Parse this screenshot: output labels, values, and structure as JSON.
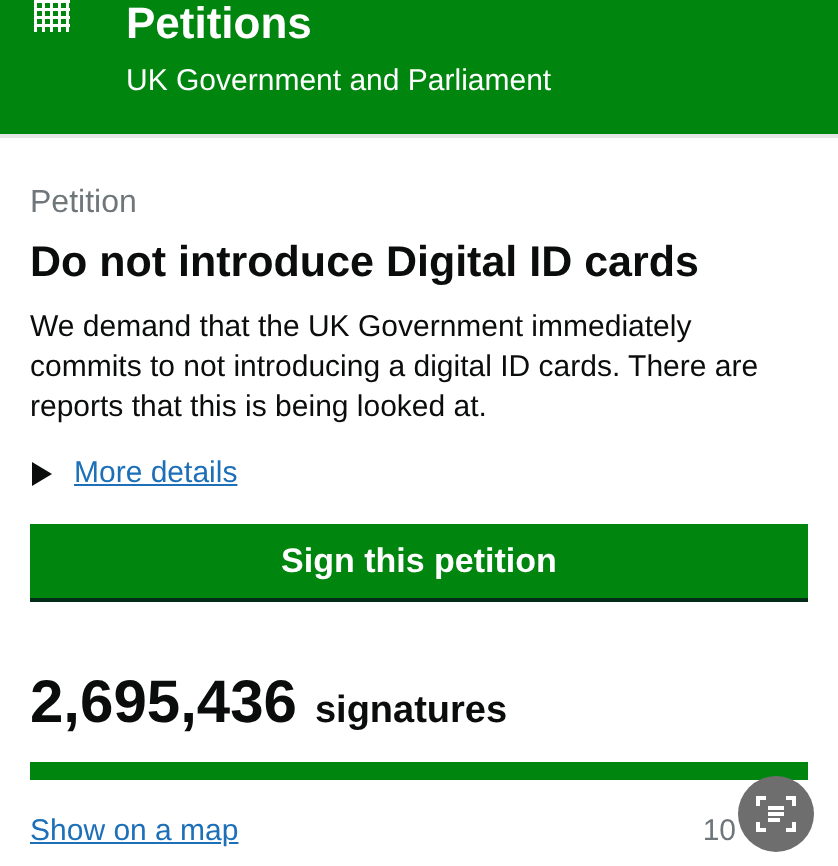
{
  "header": {
    "title": "Petitions",
    "subtitle": "UK Government and Parliament"
  },
  "petition": {
    "label": "Petition",
    "title": "Do not introduce Digital ID cards",
    "description": "We demand that the UK Government immediately commits to not introducing a digital ID cards. There are reports that this is being looked at.",
    "details_link": {
      "label": "More details",
      "expanded": false
    }
  },
  "sign_button": "Sign this petition",
  "signatures": {
    "count": "2,695,436",
    "label": "signatures",
    "level": 1
  },
  "map_link": "Show on a map",
  "target": "10"
}
